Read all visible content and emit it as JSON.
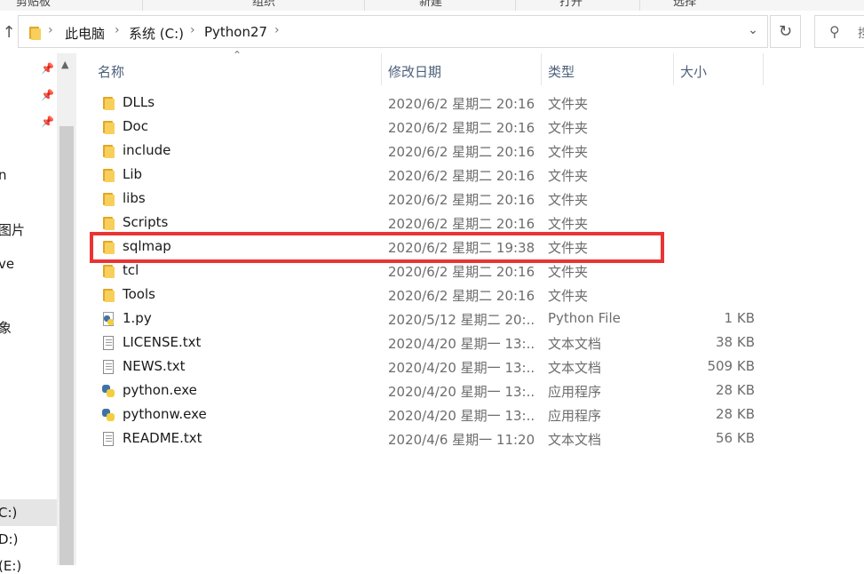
{
  "ribbon": {
    "items": [
      "剪贴板",
      "组织",
      "新建",
      "打开",
      "选择"
    ]
  },
  "address": {
    "crumbs": [
      "此电脑",
      "系统 (C:)",
      "Python27"
    ],
    "search_placeholder": "搜"
  },
  "nav": {
    "items": [
      "n",
      "图片",
      "ve",
      "象",
      "C:)",
      "D:)",
      "(E:)"
    ]
  },
  "columns": {
    "name": "名称",
    "date": "修改日期",
    "type": "类型",
    "size": "大小"
  },
  "files": [
    {
      "name": "DLLs",
      "date": "2020/6/2 星期二 20:16",
      "type": "文件夹",
      "size": "",
      "icon": "folder"
    },
    {
      "name": "Doc",
      "date": "2020/6/2 星期二 20:16",
      "type": "文件夹",
      "size": "",
      "icon": "folder"
    },
    {
      "name": "include",
      "date": "2020/6/2 星期二 20:16",
      "type": "文件夹",
      "size": "",
      "icon": "folder"
    },
    {
      "name": "Lib",
      "date": "2020/6/2 星期二 20:16",
      "type": "文件夹",
      "size": "",
      "icon": "folder"
    },
    {
      "name": "libs",
      "date": "2020/6/2 星期二 20:16",
      "type": "文件夹",
      "size": "",
      "icon": "folder"
    },
    {
      "name": "Scripts",
      "date": "2020/6/2 星期二 20:16",
      "type": "文件夹",
      "size": "",
      "icon": "folder"
    },
    {
      "name": "sqlmap",
      "date": "2020/6/2 星期二 19:38",
      "type": "文件夹",
      "size": "",
      "icon": "folder"
    },
    {
      "name": "tcl",
      "date": "2020/6/2 星期二 20:16",
      "type": "文件夹",
      "size": "",
      "icon": "folder"
    },
    {
      "name": "Tools",
      "date": "2020/6/2 星期二 20:16",
      "type": "文件夹",
      "size": "",
      "icon": "folder"
    },
    {
      "name": "1.py",
      "date": "2020/5/12 星期二 20:...",
      "type": "Python File",
      "size": "1 KB",
      "icon": "python-file"
    },
    {
      "name": "LICENSE.txt",
      "date": "2020/4/20 星期一 13:...",
      "type": "文本文档",
      "size": "38 KB",
      "icon": "text-file"
    },
    {
      "name": "NEWS.txt",
      "date": "2020/4/20 星期一 13:...",
      "type": "文本文档",
      "size": "509 KB",
      "icon": "text-file"
    },
    {
      "name": "python.exe",
      "date": "2020/4/20 星期一 13:...",
      "type": "应用程序",
      "size": "28 KB",
      "icon": "python-exe"
    },
    {
      "name": "pythonw.exe",
      "date": "2020/4/20 星期一 13:...",
      "type": "应用程序",
      "size": "28 KB",
      "icon": "python-exe"
    },
    {
      "name": "README.txt",
      "date": "2020/4/6 星期一 11:20",
      "type": "文本文档",
      "size": "56 KB",
      "icon": "text-file"
    }
  ],
  "highlighted_row": "sqlmap",
  "colors": {
    "highlight_border": "#e93434",
    "folder": "#f8cf5a",
    "header_text": "#4c607a"
  }
}
